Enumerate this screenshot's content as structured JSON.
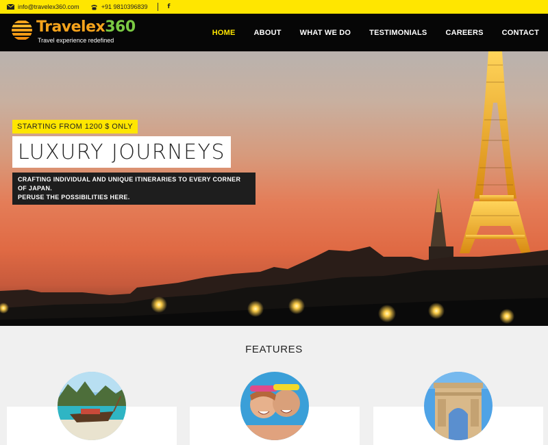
{
  "topbar": {
    "email_icon": "envelope-icon",
    "email": "info@travelex360.com",
    "phone_icon": "phone-icon",
    "phone": "+91 9810396839",
    "social_icon": "facebook-icon",
    "social_label": "f"
  },
  "header": {
    "brand_part1": "Travelex",
    "brand_part2": "360",
    "tagline": "Travel experience redefined",
    "logo_icon": "sun-stripes-logo"
  },
  "nav": {
    "items": [
      {
        "label": "HOME",
        "active": true
      },
      {
        "label": "ABOUT",
        "active": false
      },
      {
        "label": "WHAT WE DO",
        "active": false
      },
      {
        "label": "TESTIMONIALS",
        "active": false
      },
      {
        "label": "CAREERS",
        "active": false
      },
      {
        "label": "CONTACT",
        "active": false
      }
    ]
  },
  "hero": {
    "badge": "STARTING FROM 1200 $ ONLY",
    "headline": "LUXURY JOURNEYS",
    "subline_1": "CRAFTING INDIVIDUAL AND UNIQUE ITINERARIES TO EVERY CORNER OF JAPAN.",
    "subline_2": "PERUSE THE POSSIBILITIES HERE."
  },
  "features": {
    "title": "FEATURES",
    "cards": [
      {
        "image": "tropical-boat-image"
      },
      {
        "image": "couple-snorkel-image"
      },
      {
        "image": "arc-de-triomphe-image"
      }
    ]
  },
  "colors": {
    "accent_yellow": "#ffe600",
    "header_bg": "#060606",
    "brand_orange": "#f5a31c",
    "brand_green": "#7ac943"
  }
}
